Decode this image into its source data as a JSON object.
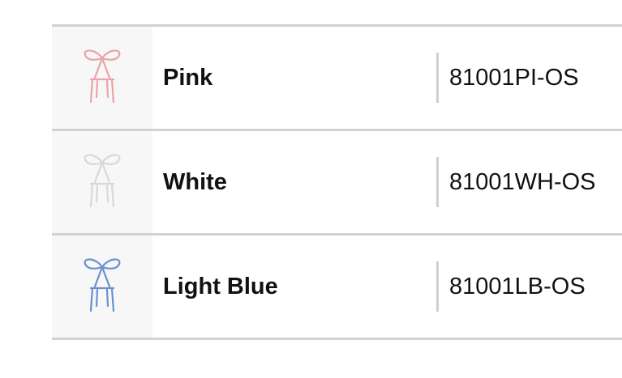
{
  "variants": [
    {
      "name": "Pink",
      "sku": "81001PI-OS",
      "color": "#eaa3a6",
      "icon": "ribbon-chair-icon"
    },
    {
      "name": "White",
      "sku": "81001WH-OS",
      "color": "#d8d8d4",
      "icon": "ribbon-chair-icon"
    },
    {
      "name": "Light Blue",
      "sku": "81001LB-OS",
      "color": "#6a90cf",
      "icon": "ribbon-chair-icon"
    }
  ]
}
